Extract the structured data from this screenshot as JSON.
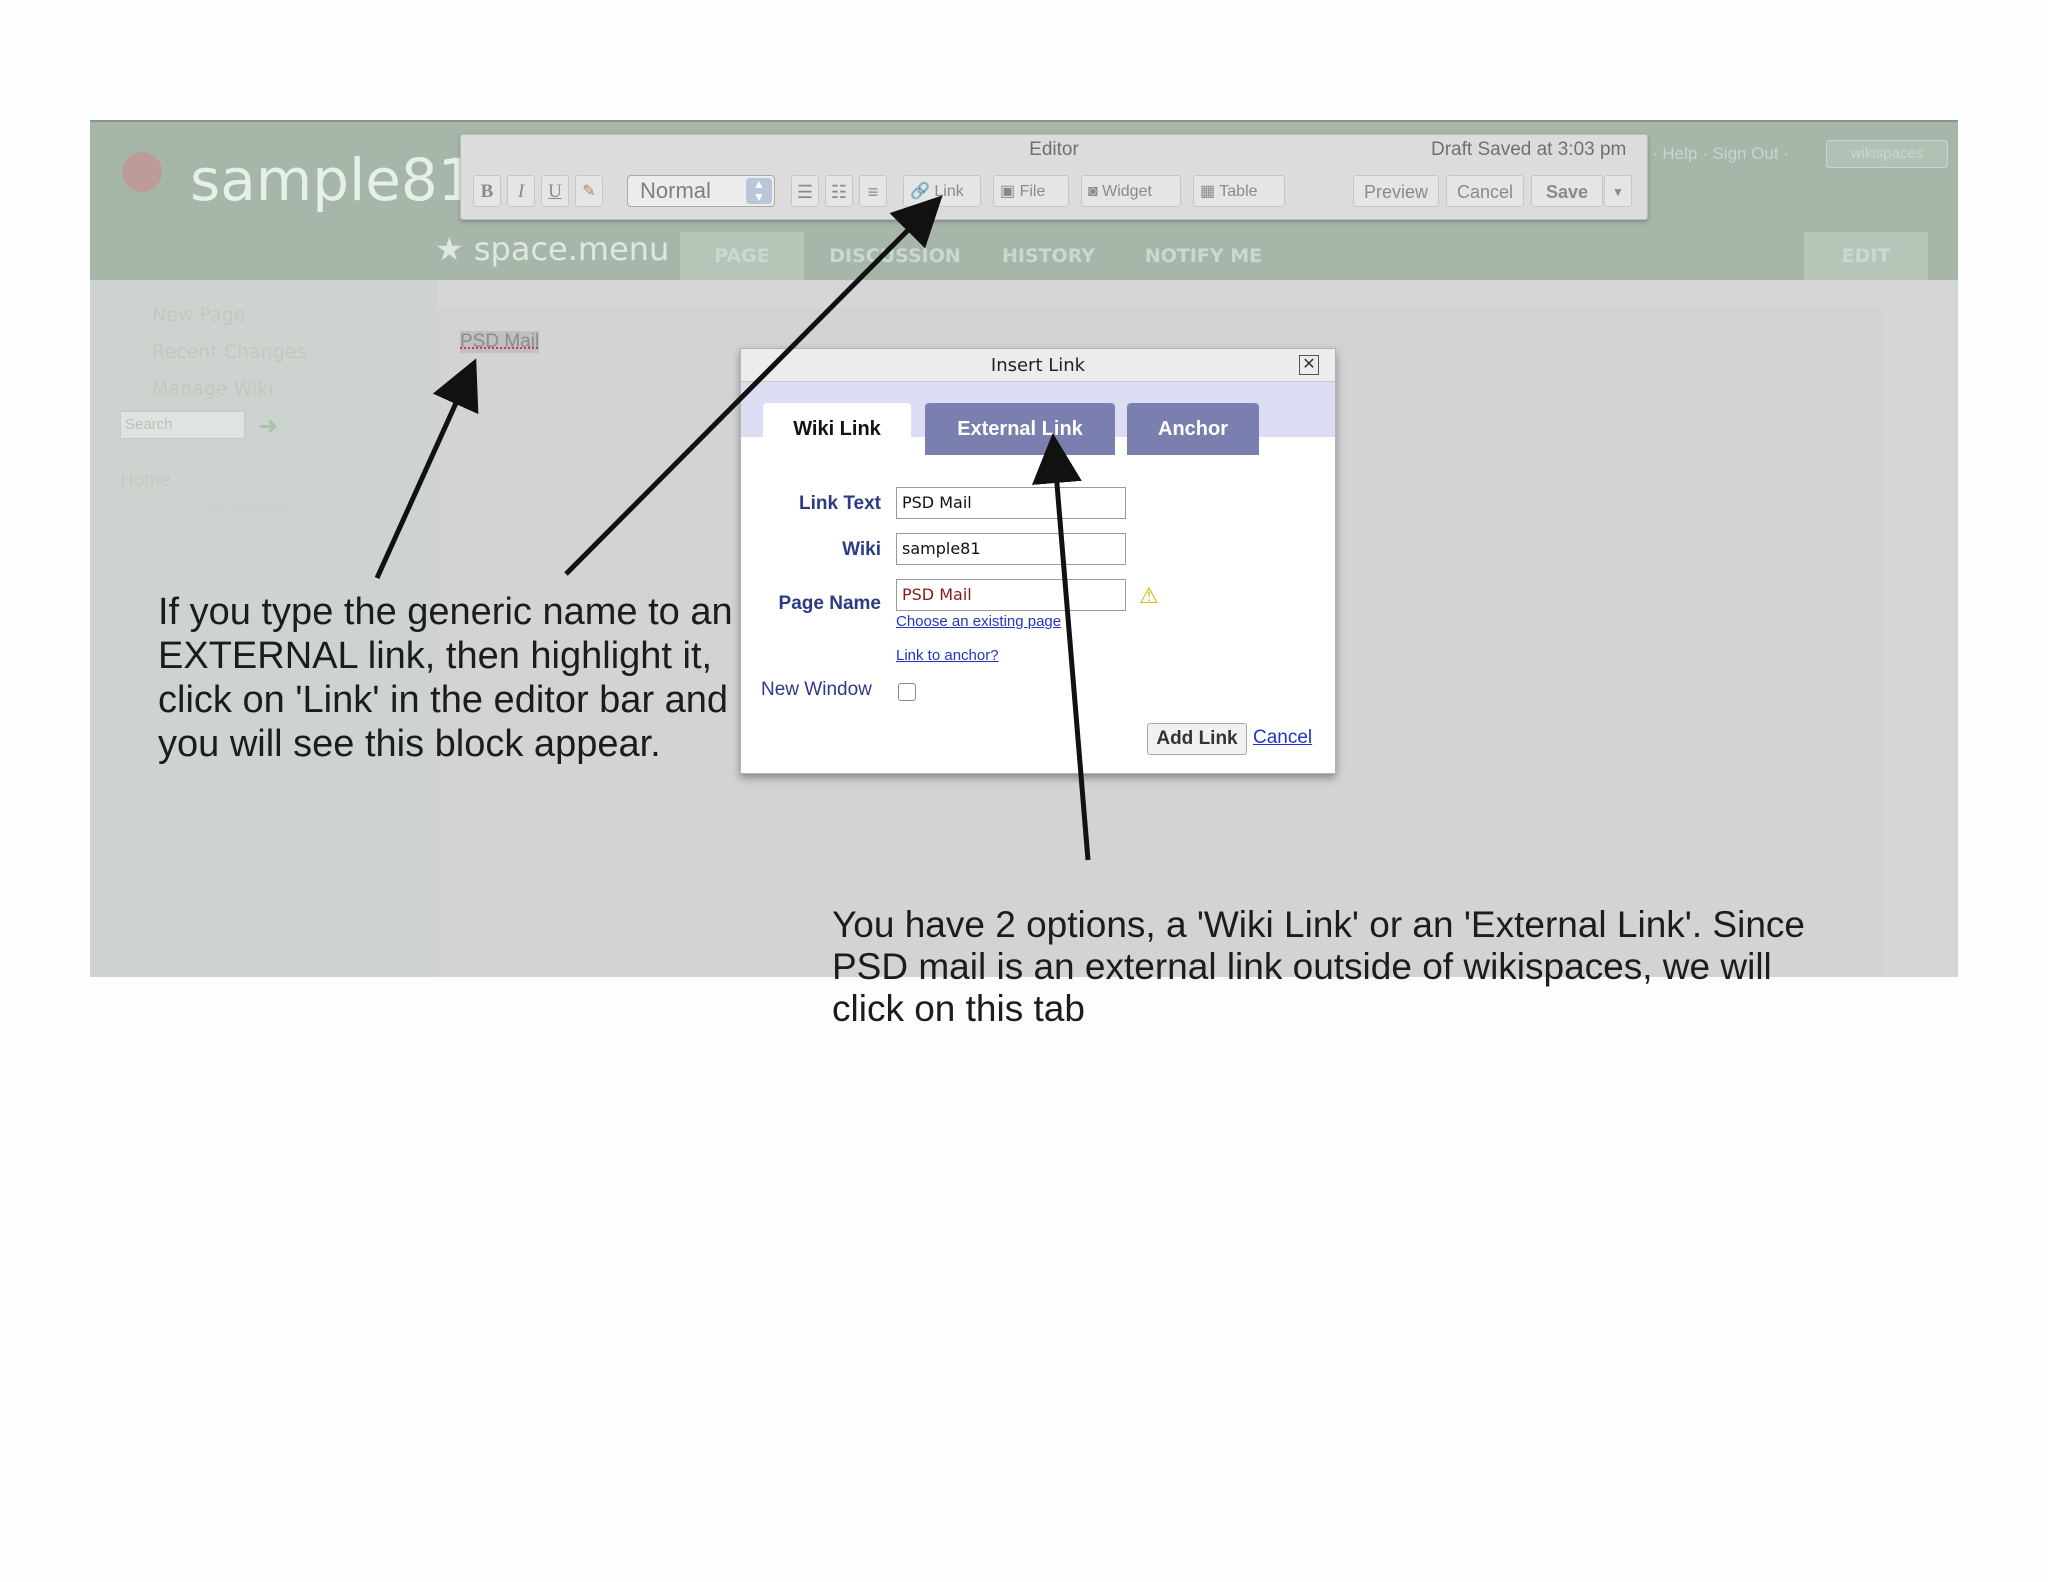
{
  "wiki": {
    "name": "sample81",
    "top_links": "· Help · Sign Out ·",
    "wikispaces_label": "wikispaces",
    "space_title": "space.menu"
  },
  "nav_tabs": [
    "PAGE",
    "DISCUSSION",
    "HISTORY",
    "NOTIFY ME",
    "EDIT"
  ],
  "sidebar": {
    "items": [
      "New Page",
      "Recent Changes",
      "Manage Wiki"
    ],
    "search_placeholder": "Search",
    "home": "Home",
    "home_sub": "edit navigation"
  },
  "page": {
    "content_text": "PSD Mail"
  },
  "editor": {
    "title": "Editor",
    "draft_status": "Draft Saved at 3:03 pm",
    "format_select": "Normal",
    "buttons": {
      "bold": "B",
      "italic": "I",
      "underline": "U",
      "link": "Link",
      "file": "File",
      "widget": "Widget",
      "table": "Table",
      "preview": "Preview",
      "cancel": "Cancel",
      "save": "Save"
    }
  },
  "dialog": {
    "title": "Insert Link",
    "tabs": [
      "Wiki Link",
      "External Link",
      "Anchor"
    ],
    "fields": {
      "link_text_label": "Link Text",
      "link_text_value": "PSD Mail",
      "wiki_label": "Wiki",
      "wiki_value": "sample81",
      "page_name_label": "Page Name",
      "page_name_value": "PSD Mail",
      "choose_existing": "Choose an existing page",
      "link_to_anchor": "Link to anchor?",
      "new_window_label": "New Window"
    },
    "add_link": "Add Link",
    "cancel": "Cancel"
  },
  "annotations": {
    "left_note": "If you type the generic name to an EXTERNAL link, then highlight it, click on 'Link' in the editor bar and you will see this block appear.",
    "bottom_note": "You have 2 options, a 'Wiki Link' or an 'External Link'. Since PSD mail is an external link outside of wikispaces, we will click on this tab"
  }
}
